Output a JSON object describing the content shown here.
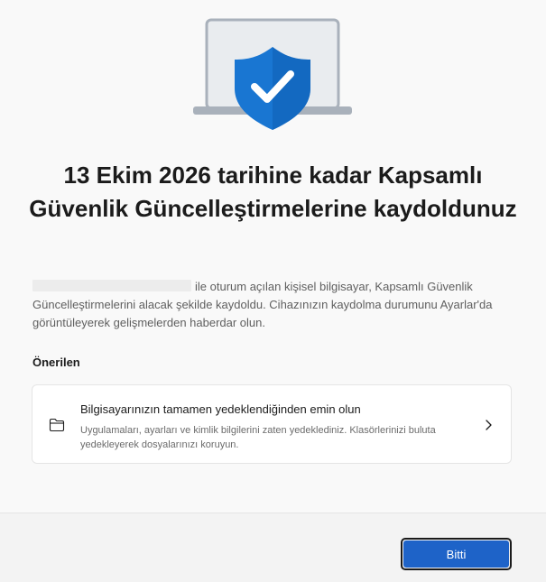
{
  "title": "13 Ekim 2026 tarihine kadar Kapsamlı Güvenlik Güncelleştirmelerine kaydoldunuz",
  "description": "ile oturum açılan kişisel bilgisayar, Kapsamlı Güvenlik Güncelleştirmelerini alacak şekilde kaydoldu. Cihazınızın kaydolma durumunu Ayarlar'da görüntüleyerek gelişmelerden haberdar olun.",
  "recommended": {
    "label": "Önerilen",
    "card": {
      "icon": "folder-icon",
      "title": "Bilgisayarınızın tamamen yedeklendiğinden emin olun",
      "description": "Uygulamaları, ayarları ve kimlik bilgilerini zaten yedeklediniz. Klasörlerinizi buluta yedekleyerek dosyalarınızı koruyun."
    }
  },
  "footer": {
    "done_label": "Bitti"
  },
  "colors": {
    "accent": "#1e63c8",
    "shield": "#1976d2"
  }
}
